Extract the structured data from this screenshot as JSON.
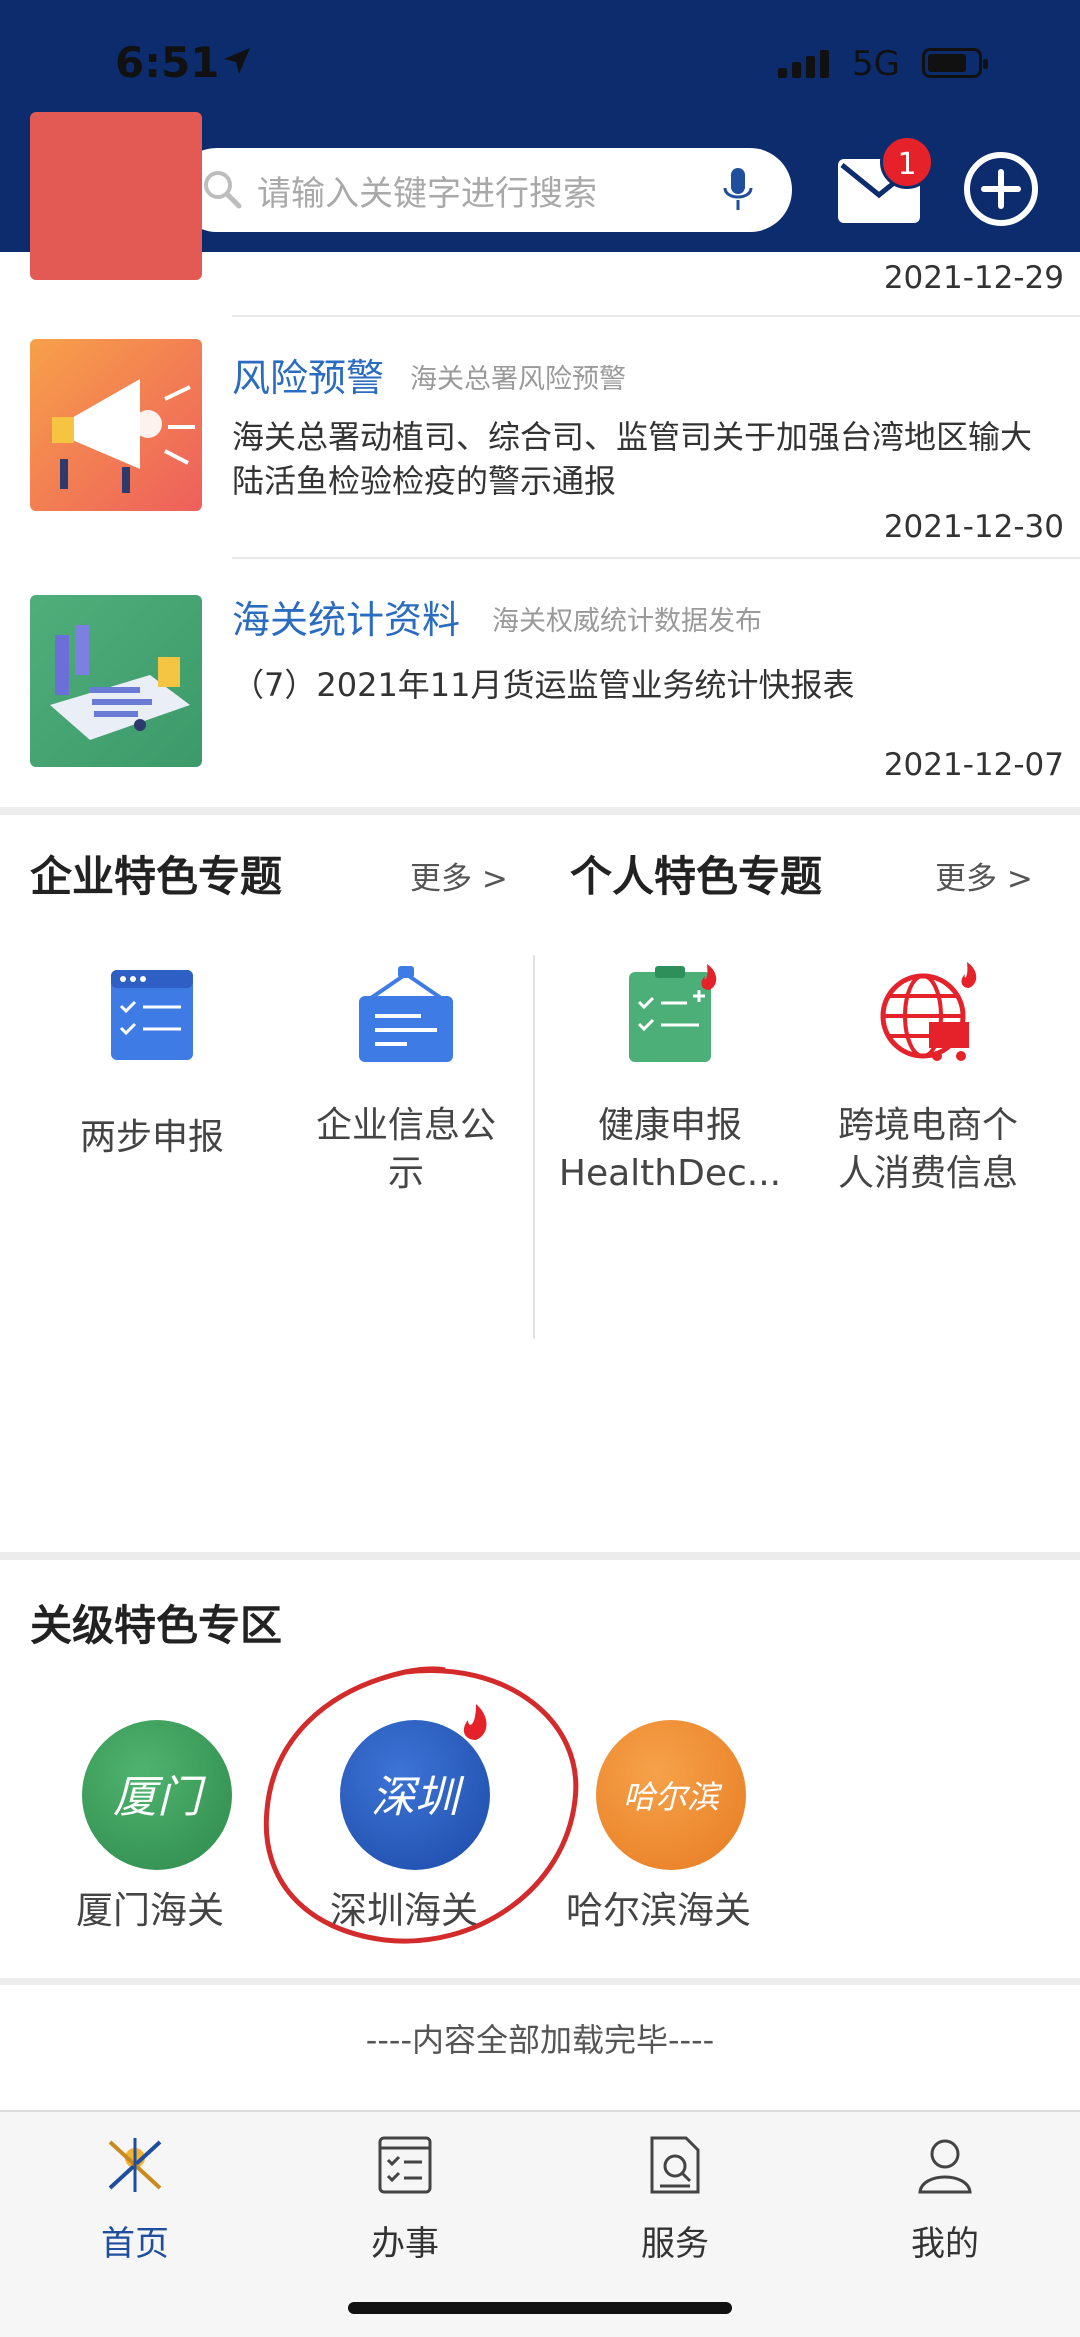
{
  "status_bar": {
    "time": "6:51",
    "network": "5G"
  },
  "header": {
    "search_placeholder": "请输入关键字进行搜索",
    "mail_badge": "1"
  },
  "news": {
    "partial_date": "2021-12-29",
    "items": [
      {
        "title": "风险预警",
        "subtitle": "海关总署风险预警",
        "body": "海关总署动植司、综合司、监管司关于加强台湾地区输大陆活鱼检验检疫的警示通报",
        "date": "2021-12-30"
      },
      {
        "title": "海关统计资料",
        "subtitle": "海关权威统计数据发布",
        "body": "（7）2021年11月货运监管业务统计快报表",
        "date": "2021-12-07"
      }
    ]
  },
  "enterprise": {
    "title": "企业特色专题",
    "more": "更多 >",
    "tiles": [
      {
        "label": "两步申报"
      },
      {
        "label": "企业信息公示"
      }
    ]
  },
  "personal": {
    "title": "个人特色专题",
    "more": "更多 >",
    "tiles": [
      {
        "label": "健康申报HealthDec..."
      },
      {
        "label": "跨境电商个人消费信息"
      }
    ]
  },
  "regional": {
    "title": "关级特色专区",
    "items": [
      {
        "label": "厦门海关",
        "logo_text": "厦门"
      },
      {
        "label": "深圳海关",
        "logo_text": "深圳"
      },
      {
        "label": "哈尔滨海关",
        "logo_text": "哈尔滨"
      }
    ]
  },
  "footer_note": "----内容全部加载完毕----",
  "bottom_nav": [
    {
      "label": "首页",
      "icon": "home-icon",
      "active": true
    },
    {
      "label": "办事",
      "icon": "tasks-icon",
      "active": false
    },
    {
      "label": "服务",
      "icon": "service-icon",
      "active": false
    },
    {
      "label": "我的",
      "icon": "profile-icon",
      "active": false
    }
  ],
  "colors": {
    "header_bg": "#0c2c6e",
    "accent_blue": "#2a6cbf",
    "badge_red": "#e5212a",
    "active_nav": "#1f4e9c"
  }
}
